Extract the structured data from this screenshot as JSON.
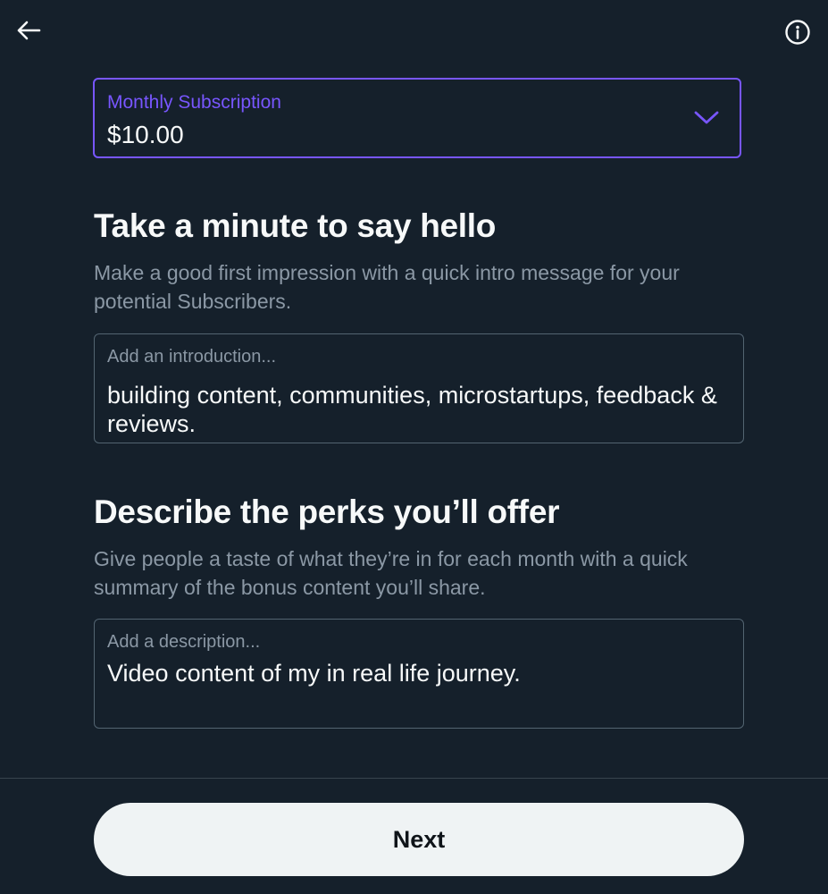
{
  "header": {
    "back_icon": "back-arrow-icon",
    "info_icon": "info-circle-icon"
  },
  "subscription": {
    "label": "Monthly Subscription",
    "value": "$10.00",
    "accent_color": "#7856ff"
  },
  "intro_section": {
    "title": "Take a minute to say hello",
    "description": "Make a good first impression with a quick intro message for your potential Subscribers.",
    "field": {
      "label": "Add an introduction...",
      "value": "building content, communities, microstartups, feedback & reviews."
    }
  },
  "perks_section": {
    "title": "Describe the perks you’ll offer",
    "description": "Give people a taste of what they’re in for each month with a quick summary of the bonus content you’ll share.",
    "field": {
      "label": "Add a description...",
      "value": "Video content of my in real life journey."
    }
  },
  "footer": {
    "next_label": "Next"
  }
}
